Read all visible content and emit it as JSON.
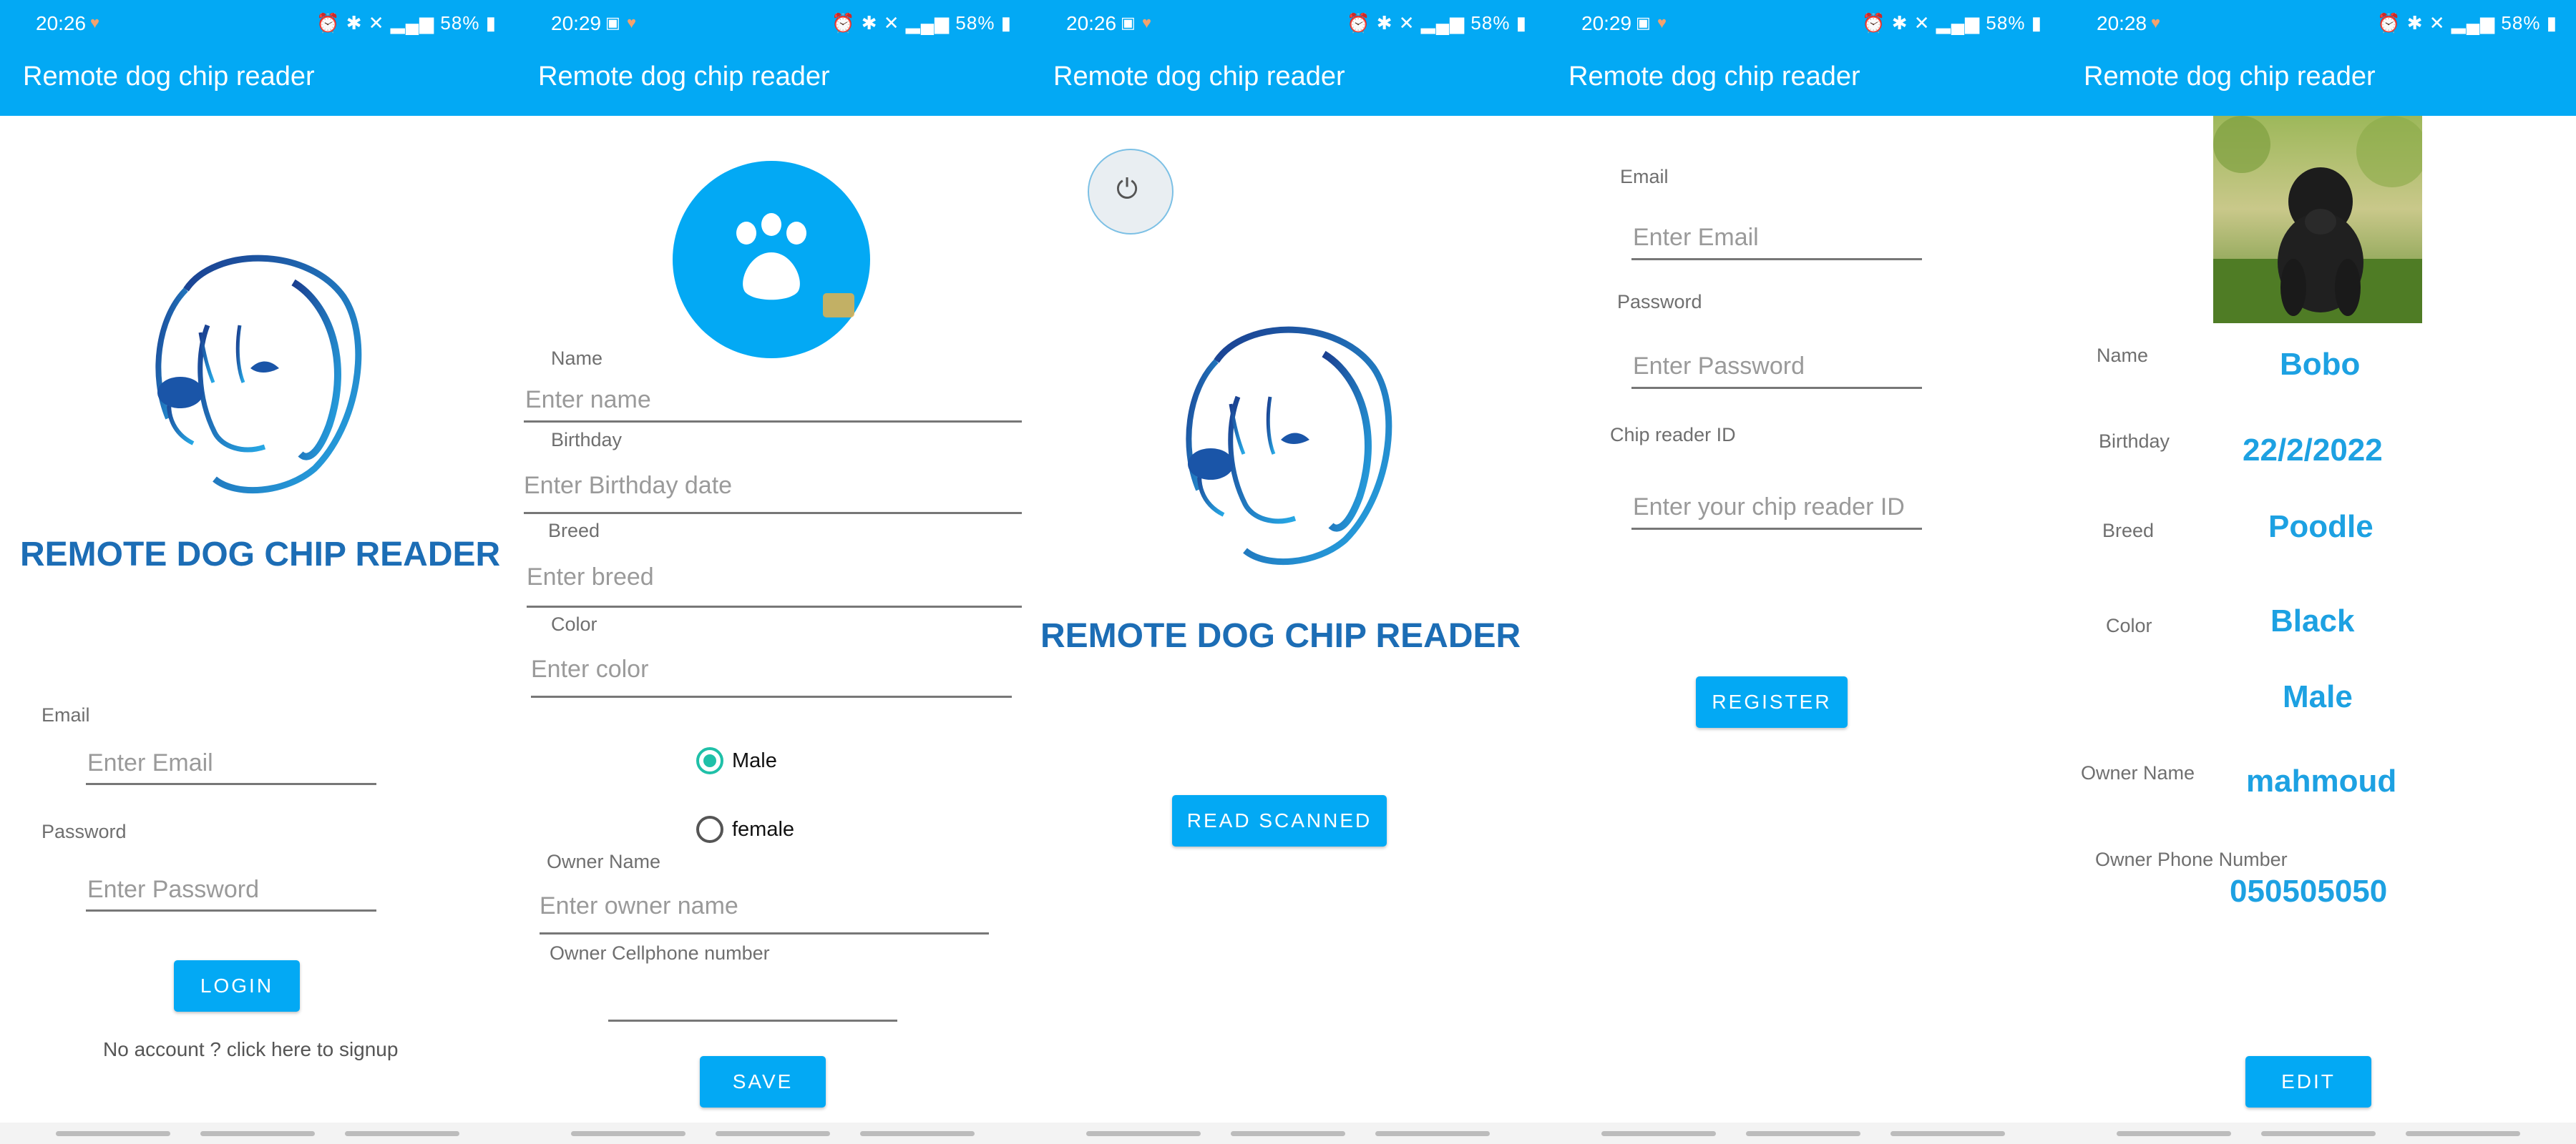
{
  "app": {
    "title": "Remote dog chip reader",
    "brand_text": "REMOTE DOG CHIP READER",
    "accent_color": "#03A9F4"
  },
  "screens": [
    {
      "status_time": "20:26",
      "battery": "58%",
      "login": {
        "email_label": "Email",
        "email_placeholder": "Enter Email",
        "password_label": "Password",
        "password_placeholder": "Enter Password",
        "login_button": "LOGIN",
        "signup_text": "No account ? click here to signup"
      }
    },
    {
      "status_time": "20:29",
      "battery": "58%",
      "form": {
        "name_label": "Name",
        "name_placeholder": "Enter name",
        "birthday_label": "Birthday",
        "birthday_placeholder": "Enter Birthday date",
        "breed_label": "Breed",
        "breed_placeholder": "Enter breed",
        "color_label": "Color",
        "color_placeholder": "Enter color",
        "gender_male": "Male",
        "gender_female": "female",
        "owner_name_label": "Owner Name",
        "owner_name_placeholder": "Enter owner name",
        "owner_phone_label": "Owner Cellphone number",
        "save_button": "SAVE"
      }
    },
    {
      "status_time": "20:26",
      "battery": "58%",
      "scan": {
        "read_button": "READ SCANNED"
      }
    },
    {
      "status_time": "20:29",
      "battery": "58%",
      "register": {
        "email_label": "Email",
        "email_placeholder": "Enter Email",
        "password_label": "Password",
        "password_placeholder": "Enter Password",
        "chip_label": "Chip reader ID",
        "chip_placeholder": "Enter your chip reader ID",
        "register_button": "REGISTER"
      }
    },
    {
      "status_time": "20:28",
      "battery": "58%",
      "profile": {
        "name_label": "Name",
        "name_value": "Bobo",
        "birthday_label": "Birthday",
        "birthday_value": "22/2/2022",
        "breed_label": "Breed",
        "breed_value": "Poodle",
        "color_label": "Color",
        "color_value": "Black",
        "gender_value": "Male",
        "owner_name_label": "Owner Name",
        "owner_name_value": "mahmoud",
        "owner_phone_label": "Owner Phone Number",
        "owner_phone_value": "050505050",
        "edit_button": "EDIT"
      }
    }
  ]
}
